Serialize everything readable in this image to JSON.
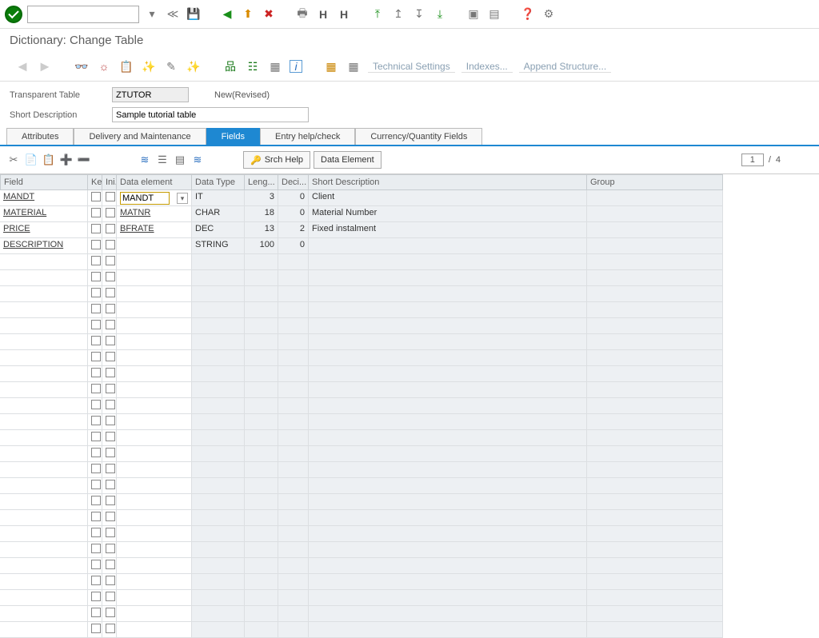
{
  "header": {
    "title": "Dictionary: Change Table"
  },
  "subbar": {
    "tech_settings": "Technical Settings",
    "indexes": "Indexes...",
    "append": "Append Structure..."
  },
  "form": {
    "table_lbl": "Transparent Table",
    "table_val": "ZTUTOR",
    "status": "New(Revised)",
    "desc_lbl": "Short Description",
    "desc_val": "Sample tutorial table"
  },
  "tabs": {
    "attributes": "Attributes",
    "delivery": "Delivery and Maintenance",
    "fields": "Fields",
    "entryhelp": "Entry help/check",
    "currency": "Currency/Quantity Fields"
  },
  "fieldsbar": {
    "srch_help": "Srch Help",
    "data_element": "Data Element"
  },
  "pager": {
    "current": "1",
    "sep": "/",
    "total": "4"
  },
  "columns": {
    "field": "Field",
    "key": "Key",
    "init": "Ini...",
    "data_element": "Data element",
    "data_type": "Data Type",
    "length": "Leng...",
    "deci": "Deci...",
    "short": "Short Description",
    "group": "Group"
  },
  "rows": [
    {
      "field": "MANDT",
      "de": "MANDT",
      "editing": true,
      "dt": "IT",
      "len": "3",
      "dec": "0",
      "sd": "Client"
    },
    {
      "field": "MATERIAL",
      "de": "MATNR",
      "dt": "CHAR",
      "len": "18",
      "dec": "0",
      "sd": "Material Number"
    },
    {
      "field": "PRICE",
      "de": "BFRATE",
      "dt": "DEC",
      "len": "13",
      "dec": "2",
      "sd": "Fixed instalment"
    },
    {
      "field": "DESCRIPTION",
      "de": "",
      "dt": "STRING",
      "len": "100",
      "dec": "0",
      "sd": ""
    }
  ],
  "empty_rows": 24
}
